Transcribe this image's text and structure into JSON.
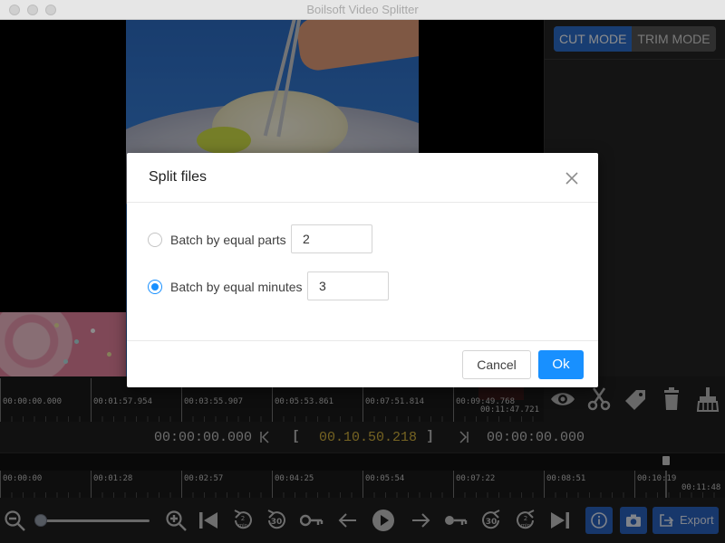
{
  "window": {
    "title": "Boilsoft Video Splitter"
  },
  "modes": {
    "cut": "CUT MODE",
    "trim": "TRIM MODE",
    "active": "cut"
  },
  "timeline_top": {
    "labels": [
      "00:00:00.000",
      "00:01:57.954",
      "00:03:55.907",
      "00:05:53.861",
      "00:07:51.814",
      "00:09:49.768"
    ],
    "end_label": "00:11:47.721"
  },
  "time_row": {
    "start": "00:00:00.000",
    "current": "00.10.50.218",
    "end": "00:00:00.000",
    "prev_glyph": "K",
    "bracket_open": "[",
    "bracket_close": "]",
    "next_glyph": "K"
  },
  "timeline_bottom": {
    "labels": [
      "00:00:00",
      "00:01:28",
      "00:02:57",
      "00:04:25",
      "00:05:54",
      "00:07:22",
      "00:08:51",
      "00:10:19"
    ],
    "end_label": "00:11:48"
  },
  "controls": {
    "zoom_level": 0.0,
    "rewind_2min": "2 min",
    "rewind_30": "30",
    "forward_30": "30",
    "forward_2min": "2 min",
    "export_label": "Export"
  },
  "dialog": {
    "title": "Split files",
    "options": [
      {
        "label": "Batch by equal parts",
        "value": "2",
        "checked": false
      },
      {
        "label": "Batch by equal minutes",
        "value": "3",
        "checked": true
      }
    ],
    "cancel_label": "Cancel",
    "ok_label": "Ok"
  },
  "colors": {
    "accent_blue": "#1890ff",
    "mode_blue": "#2d6fd0",
    "time_gold": "#d6b43e"
  }
}
